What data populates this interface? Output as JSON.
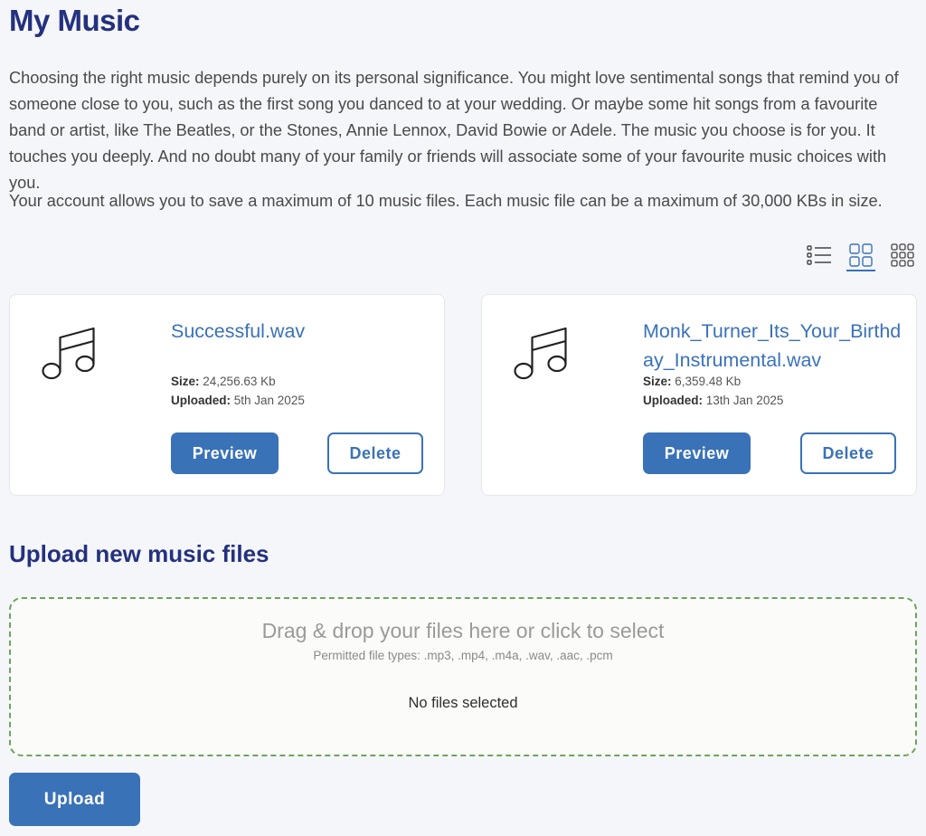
{
  "page": {
    "title": "My Music",
    "intro": "Choosing the right music depends purely on its personal significance. You might love sentimental songs that remind you of someone close to you, such as the first song you danced to at your wedding. Or maybe some hit songs from a favourite band or artist, like The Beatles, or the Stones, Annie Lennox, David Bowie or Adele. The music you choose is for you. It touches you deeply. And no doubt many of your family or friends will associate some of your favourite music choices with you.",
    "limits": "Your account allows you to save a maximum of 10 music files. Each music file can be a maximum of 30,000 KBs in size."
  },
  "view_toggle": {
    "options": [
      {
        "icon": "list-view-icon",
        "active": false
      },
      {
        "icon": "grid-view-icon",
        "active": true
      },
      {
        "icon": "compact-grid-view-icon",
        "active": false
      }
    ]
  },
  "files": [
    {
      "icon": "music-note-icon",
      "name": "Successful.wav",
      "size_label": "Size:",
      "size": "24,256.63 Kb",
      "uploaded_label": "Uploaded:",
      "uploaded": "5th Jan 2025",
      "preview_label": "Preview",
      "delete_label": "Delete"
    },
    {
      "icon": "music-note-icon",
      "name": "Monk_Turner_Its_Your_Birthday_Instrumental.wav",
      "size_label": "Size:",
      "size": "6,359.48 Kb",
      "uploaded_label": "Uploaded:",
      "uploaded": "13th Jan 2025",
      "preview_label": "Preview",
      "delete_label": "Delete"
    }
  ],
  "upload": {
    "title": "Upload new music files",
    "drop_text": "Drag & drop your files here or click to select",
    "permitted_types": "Permitted file types: .mp3, .mp4, .m4a, .wav, .aac, .pcm",
    "status": "No files selected",
    "button_label": "Upload"
  },
  "colors": {
    "heading": "#24317f",
    "accent": "#3a72b8",
    "dropzone_border": "#6aa65a",
    "background": "#f5f6fa"
  }
}
